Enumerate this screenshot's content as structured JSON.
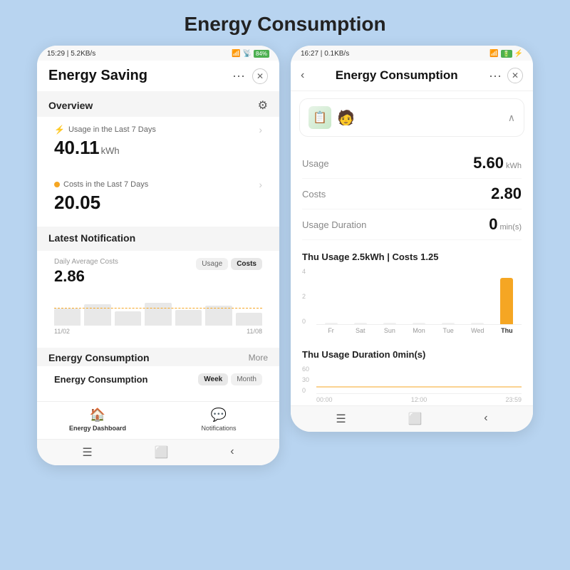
{
  "pageTitle": "Energy Consumption",
  "phone1": {
    "statusBar": {
      "time": "15:29",
      "network": "5.2KB/s",
      "battery": "84%"
    },
    "header": {
      "title": "Energy Saving",
      "dotsLabel": "···",
      "closeLabel": "✕"
    },
    "overview": {
      "label": "Overview",
      "usageCard": {
        "label": "Usage in the Last 7 Days",
        "value": "40.11",
        "unit": "kWh"
      },
      "costsCard": {
        "label": "Costs in the Last 7 Days",
        "value": "20.05"
      }
    },
    "notification": {
      "sectionLabel": "Latest Notification",
      "sublabel": "Daily Average Costs",
      "value": "2.86",
      "tabs": [
        "Usage",
        "Costs"
      ],
      "activeTab": "Costs",
      "dateStart": "11/02",
      "dateEnd": "11/08"
    },
    "energySection": {
      "label": "Energy Consumption",
      "moreLabel": "More",
      "cardTitle": "Energy Consumption",
      "tabs": [
        "Week",
        "Month"
      ],
      "activeTab": "Week"
    },
    "bottomNav": {
      "items": [
        {
          "label": "Energy Dashboard",
          "icon": "⬤"
        },
        {
          "label": "Notifications",
          "icon": "💬"
        }
      ]
    },
    "systemNav": {
      "menu": "☰",
      "home": "⬜",
      "back": "‹"
    }
  },
  "phone2": {
    "statusBar": {
      "time": "16:27",
      "network": "0.1KB/s",
      "battery": "🟩"
    },
    "header": {
      "backLabel": "‹",
      "title": "Energy Consumption",
      "dotsLabel": "···",
      "closeLabel": "✕"
    },
    "device": {
      "iconLabel": "📋"
    },
    "stats": [
      {
        "label": "Usage",
        "value": "5.60",
        "unit": "kWh"
      },
      {
        "label": "Costs",
        "value": "2.80",
        "unit": ""
      },
      {
        "label": "Usage Duration",
        "value": "0",
        "unit": "min(s)"
      }
    ],
    "barChart": {
      "title": "Thu Usage 2.5kWh | Costs 1.25",
      "yLabels": [
        "4",
        "2",
        "0"
      ],
      "days": [
        {
          "label": "Fr",
          "height": 0,
          "highlight": false
        },
        {
          "label": "Sat",
          "height": 0,
          "highlight": false
        },
        {
          "label": "Sun",
          "height": 0,
          "highlight": false
        },
        {
          "label": "Mon",
          "height": 0,
          "highlight": false
        },
        {
          "label": "Tue",
          "height": 0,
          "highlight": false
        },
        {
          "label": "Wed",
          "height": 0,
          "highlight": false
        },
        {
          "label": "Thu",
          "height": 65,
          "highlight": true
        }
      ]
    },
    "durationChart": {
      "title": "Thu Usage Duration 0min(s)",
      "yLabels": [
        "60",
        "30",
        "0"
      ],
      "xLabels": [
        "00:00",
        "12:00",
        "23:59"
      ]
    },
    "systemNav": {
      "menu": "☰",
      "home": "⬜",
      "back": "‹"
    }
  }
}
